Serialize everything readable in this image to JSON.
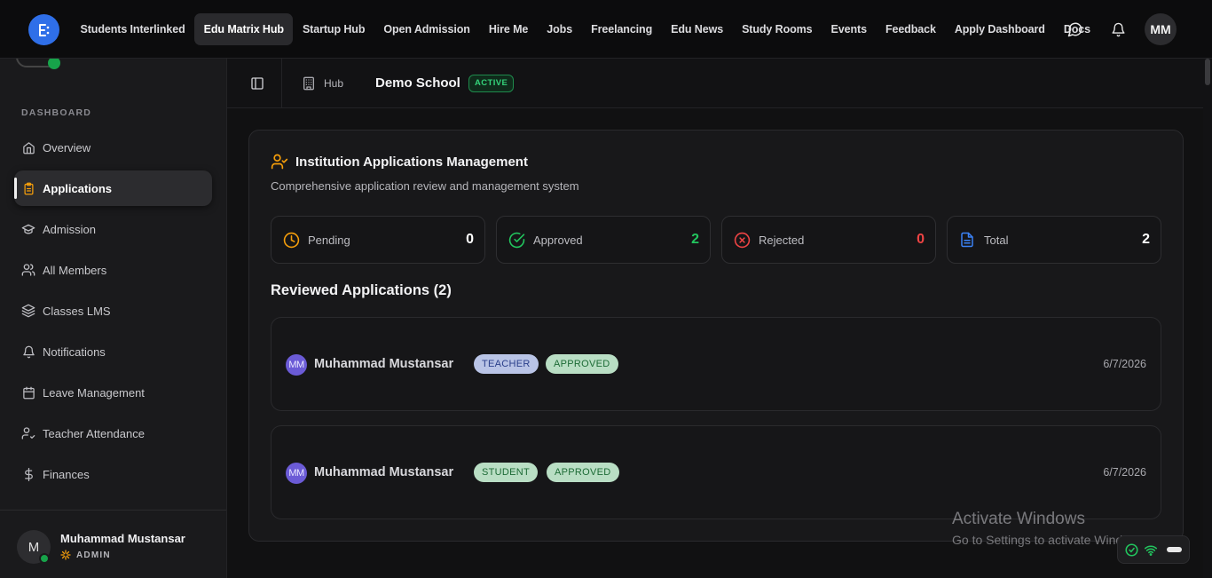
{
  "topnav": {
    "logo_icon": "edu-matrix-logo-icon",
    "links": [
      {
        "label": "Students Interlinked",
        "active": false
      },
      {
        "label": "Edu Matrix Hub",
        "active": true
      },
      {
        "label": "Startup Hub",
        "active": false
      },
      {
        "label": "Open Admission",
        "active": false
      },
      {
        "label": "Hire Me",
        "active": false
      },
      {
        "label": "Jobs",
        "active": false
      },
      {
        "label": "Freelancing",
        "active": false
      },
      {
        "label": "Edu News",
        "active": false
      },
      {
        "label": "Study Rooms",
        "active": false
      },
      {
        "label": "Events",
        "active": false
      },
      {
        "label": "Feedback",
        "active": false
      },
      {
        "label": "Apply Dashboard",
        "active": false
      },
      {
        "label": "Docs",
        "active": false
      }
    ],
    "messages_icon": "message-circle-icon",
    "notifications_icon": "bell-icon",
    "user_initials": "MM"
  },
  "sidebar": {
    "section_label": "DASHBOARD",
    "items": [
      {
        "label": "Overview",
        "icon": "home-icon",
        "active": false
      },
      {
        "label": "Applications",
        "icon": "clipboard-icon",
        "active": true
      },
      {
        "label": "Admission",
        "icon": "graduation-cap-icon",
        "active": false
      },
      {
        "label": "All Members",
        "icon": "users-icon",
        "active": false
      },
      {
        "label": "Classes LMS",
        "icon": "layers-icon",
        "active": false
      },
      {
        "label": "Notifications",
        "icon": "bell-icon",
        "active": false
      },
      {
        "label": "Leave Management",
        "icon": "calendar-icon",
        "active": false
      },
      {
        "label": "Teacher Attendance",
        "icon": "user-check-icon",
        "active": false
      },
      {
        "label": "Finances",
        "icon": "dollar-icon",
        "active": false
      }
    ],
    "user": {
      "initial": "M",
      "name": "Muhammad Mustansar",
      "role": "ADMIN"
    }
  },
  "header": {
    "breadcrumb_hub": "Hub",
    "school_name": "Demo School",
    "status_badge": "ACTIVE"
  },
  "main": {
    "title": "Institution Applications Management",
    "subtitle": "Comprehensive application review and management system",
    "stats": [
      {
        "label": "Pending",
        "value": "0",
        "icon": "clock-icon",
        "color": "#f59e0b",
        "value_color": "#ffffff"
      },
      {
        "label": "Approved",
        "value": "2",
        "icon": "check-circle-icon",
        "color": "#22c55e",
        "value_color": "#22c55e"
      },
      {
        "label": "Rejected",
        "value": "0",
        "icon": "x-circle-icon",
        "color": "#ef4444",
        "value_color": "#ef4444"
      },
      {
        "label": "Total",
        "value": "2",
        "icon": "file-icon",
        "color": "#3b82f6",
        "value_color": "#ffffff"
      }
    ],
    "reviewed_title": "Reviewed Applications (2)",
    "applications": [
      {
        "initials": "MM",
        "name": "Muhammad Mustansar",
        "role_tag": "TEACHER",
        "status_tag": "APPROVED",
        "date": "6/7/2026"
      },
      {
        "initials": "MM",
        "name": "Muhammad Mustansar",
        "role_tag": "STUDENT",
        "status_tag": "APPROVED",
        "date": "6/7/2026"
      }
    ]
  },
  "watermark": {
    "line1": "Activate Windows",
    "line2": "Go to Settings to activate Windows."
  },
  "colors": {
    "accent_blue": "#2f6fe8",
    "approved_bg": "#b9dec4",
    "approved_text": "#1d6b36",
    "teacher_bg": "#b9c4e6",
    "teacher_text": "#2a3f8a",
    "student_bg": "#b9dec4",
    "student_text": "#1d6b36"
  }
}
